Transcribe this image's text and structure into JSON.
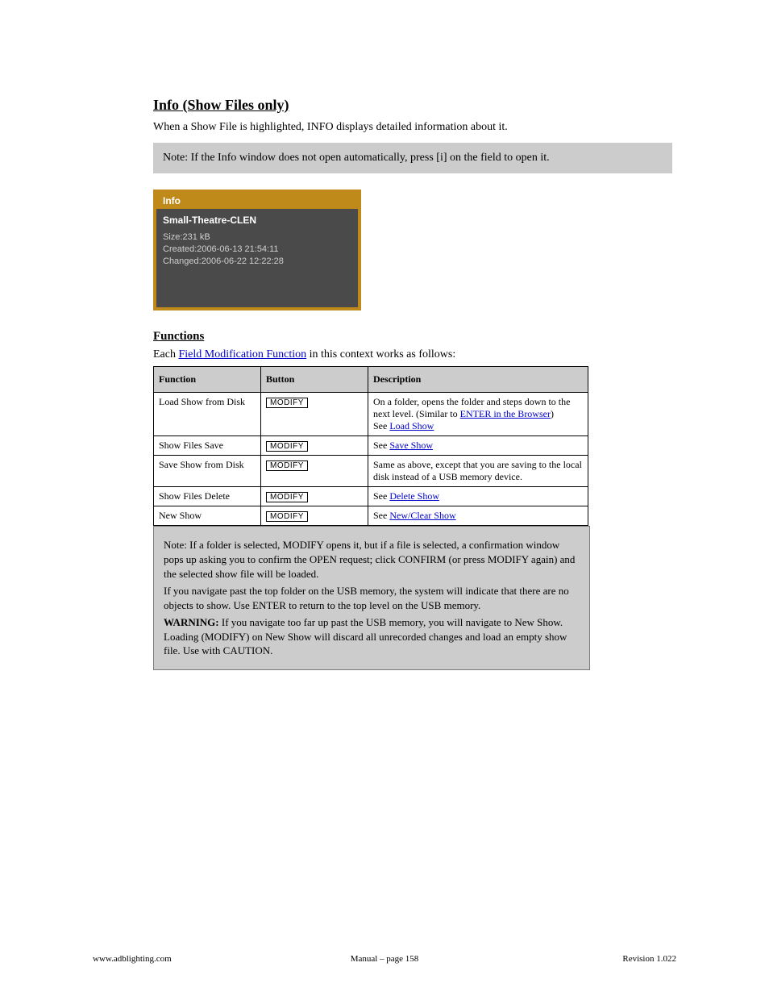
{
  "section": {
    "title": "Info (Show Files only)",
    "intro": "When a Show File is highlighted, INFO displays detailed information about it.",
    "note": "Note: If the Info window does not open automatically, press [i] on the field to open it."
  },
  "info_panel": {
    "title": "Info",
    "name": "Small-Theatre-CLEN",
    "size_label": "Size:",
    "size_value": "231 kB",
    "created_label": "Created:",
    "created_value": "2006-06-13 21:54:11",
    "changed_label": "Changed:",
    "changed_value": "2006-06-22 12:22:28"
  },
  "functions": {
    "heading": "Functions",
    "intro_pre": "Each ",
    "intro_link": "Field Modification Function",
    "intro_post": " in this context works as follows:",
    "table": {
      "headers": [
        "Function",
        "Button",
        "Description"
      ],
      "rows": [
        {
          "fn": "Load Show from Disk",
          "btn": "MODIFY",
          "desc_pre": "On a folder, opens the folder and steps down to the next level. (Similar to ",
          "desc_link": "ENTER in the Browser",
          "desc_post": ")",
          "see": "Load Show"
        },
        {
          "fn": "Show Files Save",
          "btn": "MODIFY",
          "desc_pre": "See ",
          "desc_link": "Save Show",
          "desc_post": ""
        },
        {
          "fn": "Save Show from Disk",
          "btn": "MODIFY",
          "desc_pre": "Same as above, except that you are saving to the local disk instead of a USB memory device.",
          "desc_link": "",
          "desc_post": ""
        },
        {
          "fn": "Show Files Delete",
          "btn": "MODIFY",
          "desc_pre": "See ",
          "desc_link": "Delete Show",
          "desc_post": ""
        },
        {
          "fn": "New Show",
          "btn": "MODIFY",
          "desc_pre": "See ",
          "desc_link": "New/Clear Show",
          "desc_post": ""
        }
      ]
    },
    "bottom_note": {
      "l1": "Note: If a folder is selected, MODIFY opens it, but if a file is selected, a confirmation window pops up asking you to confirm the OPEN request; click CONFIRM (or press MODIFY again) and the selected show file will be loaded.",
      "l2": "If you navigate past the top folder on the USB memory, the system will indicate that there are no objects to show. Use ENTER to return to the top level on the USB memory.",
      "warn_strong": "WARNING:",
      "warn_rest": " If you navigate too far up past the USB memory, you will navigate to New Show. Loading (MODIFY) on New Show will discard all unrecorded changes and load an empty show file. Use with CAUTION."
    }
  },
  "footer": {
    "left": "www.adblighting.com",
    "center": "Manual – page 158",
    "right": "Revision 1.022"
  }
}
